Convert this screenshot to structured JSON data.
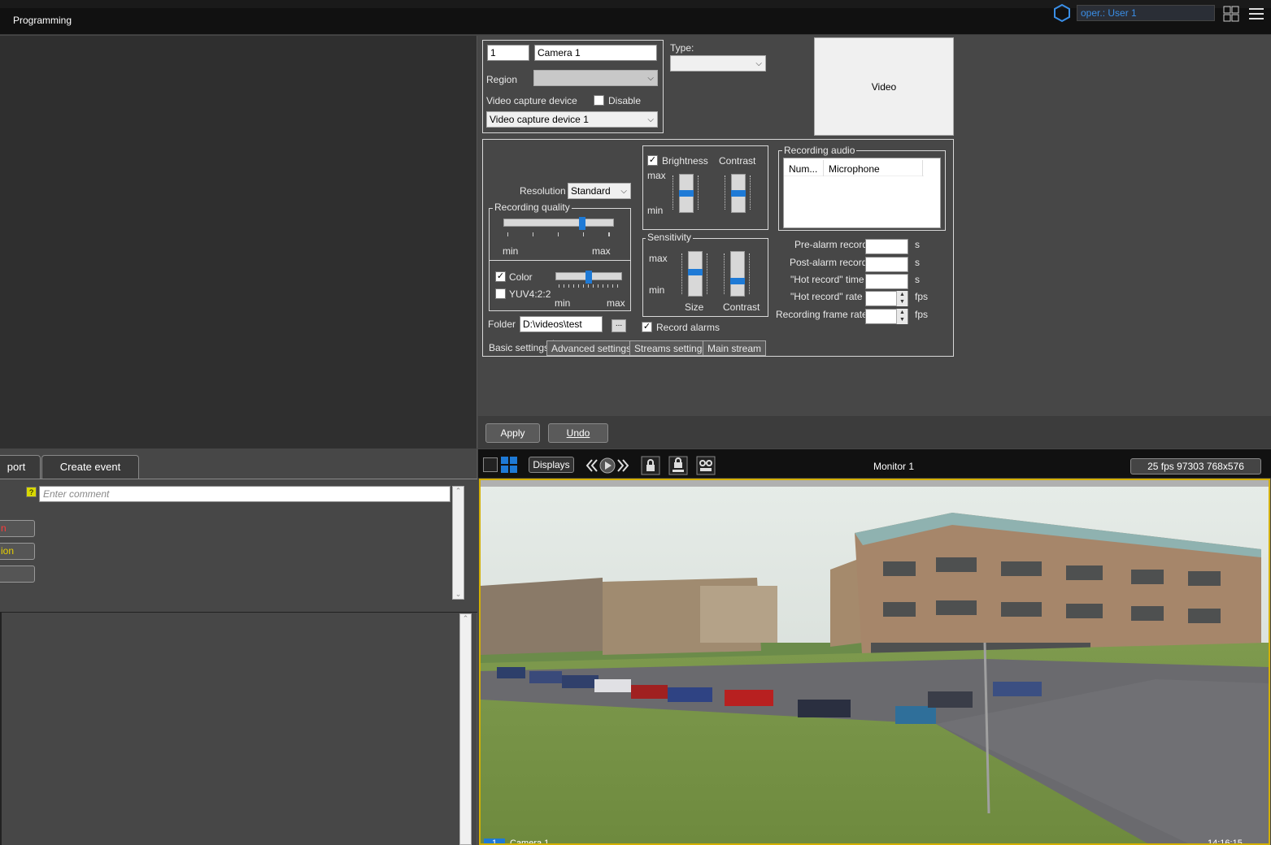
{
  "app": {
    "title": "Programming",
    "user": "oper.: User 1"
  },
  "camera": {
    "number": "1",
    "name": "Camera 1",
    "region_label": "Region",
    "region_value": "",
    "vcd_label": "Video capture device",
    "disable_label": "Disable",
    "vcd_value": "Video capture device 1",
    "type_label": "Type:",
    "type_value": "",
    "video_label": "Video"
  },
  "settings": {
    "resolution_label": "Resolution",
    "resolution_value": "Standard",
    "recording_quality": "Recording quality",
    "quality_level": 0.73,
    "min": "min",
    "max": "max",
    "color_label": "Color",
    "color_level": 0.5,
    "yuv_label": "YUV4:2:2",
    "brightness_label": "Brightness",
    "brightness_level": 0.5,
    "contrast_label": "Contrast",
    "contrast_level": 0.5,
    "sensitivity_label": "Sensitivity",
    "size_label": "Size",
    "size_level": 0.55,
    "sens_contrast_level": 0.3,
    "folder_label": "Folder",
    "folder_value": "D:\\videos\\test",
    "browse_label": "...",
    "record_alarms_label": "Record alarms",
    "recording_audio_label": "Recording audio",
    "audio_col_num": "Num...",
    "audio_col_mic": "Microphone",
    "pre_alarm": "Pre-alarm record",
    "post_alarm": "Post-alarm record",
    "hot_time": "\"Hot record\" time",
    "hot_rate": "\"Hot record\" rate",
    "frame_rate": "Recording frame rate",
    "unit_s": "s",
    "unit_fps": "fps"
  },
  "tabs": [
    "Basic settings",
    "Advanced settings",
    "Streams settings",
    "Main stream"
  ],
  "buttons": {
    "apply": "Apply",
    "undo": "Undo"
  },
  "bottom_left": {
    "tab_report": "port",
    "tab_create_event": "Create event",
    "comment_placeholder": "Enter comment",
    "help": "?",
    "btn1": "n",
    "btn2": "ion",
    "btn3": ""
  },
  "monitor": {
    "displays": "Displays",
    "name": "Monitor 1",
    "status": "25 fps  97303 768x576",
    "cam_num": "1",
    "cam_name": "Camera 1",
    "time": "14:16:15"
  },
  "colors": {
    "accent": "#1e7ad6",
    "video_border": "#d4b000"
  }
}
